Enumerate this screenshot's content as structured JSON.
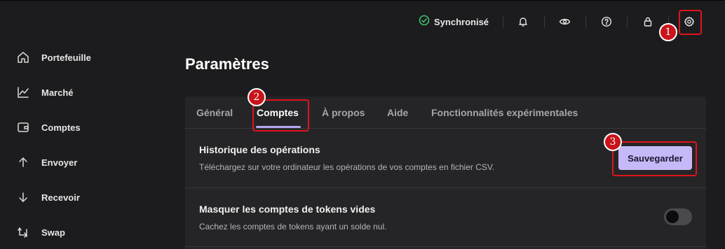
{
  "sidebar": {
    "items": [
      {
        "label": "Portefeuille",
        "icon": "home-icon"
      },
      {
        "label": "Marché",
        "icon": "chart-line-icon"
      },
      {
        "label": "Comptes",
        "icon": "wallet-icon"
      },
      {
        "label": "Envoyer",
        "icon": "arrow-up-icon"
      },
      {
        "label": "Recevoir",
        "icon": "arrow-down-icon"
      },
      {
        "label": "Swap",
        "icon": "swap-icon"
      }
    ]
  },
  "topbar": {
    "sync_label": "Synchronisé",
    "icons": [
      "check-circle-icon",
      "bell-icon",
      "eye-icon",
      "help-icon",
      "lock-icon",
      "gear-icon"
    ]
  },
  "page": {
    "title": "Paramètres"
  },
  "tabs": [
    {
      "label": "Général",
      "active": false
    },
    {
      "label": "Comptes",
      "active": true
    },
    {
      "label": "À propos",
      "active": false
    },
    {
      "label": "Aide",
      "active": false
    },
    {
      "label": "Fonctionnalités expérimentales",
      "active": false
    }
  ],
  "settings": {
    "history": {
      "title": "Historique des opérations",
      "description": "Téléchargez sur votre ordinateur les opérations de vos comptes en fichier CSV.",
      "button_label": "Sauvegarder"
    },
    "hide_empty": {
      "title": "Masquer les comptes de tokens vides",
      "description": "Cachez les comptes de tokens ayant un solde nul.",
      "enabled": false
    }
  },
  "annotations": [
    "1",
    "2",
    "3"
  ],
  "colors": {
    "accent": "#c6b9f7",
    "sync_ok": "#3fbf70",
    "annotation": "#e0141b"
  }
}
